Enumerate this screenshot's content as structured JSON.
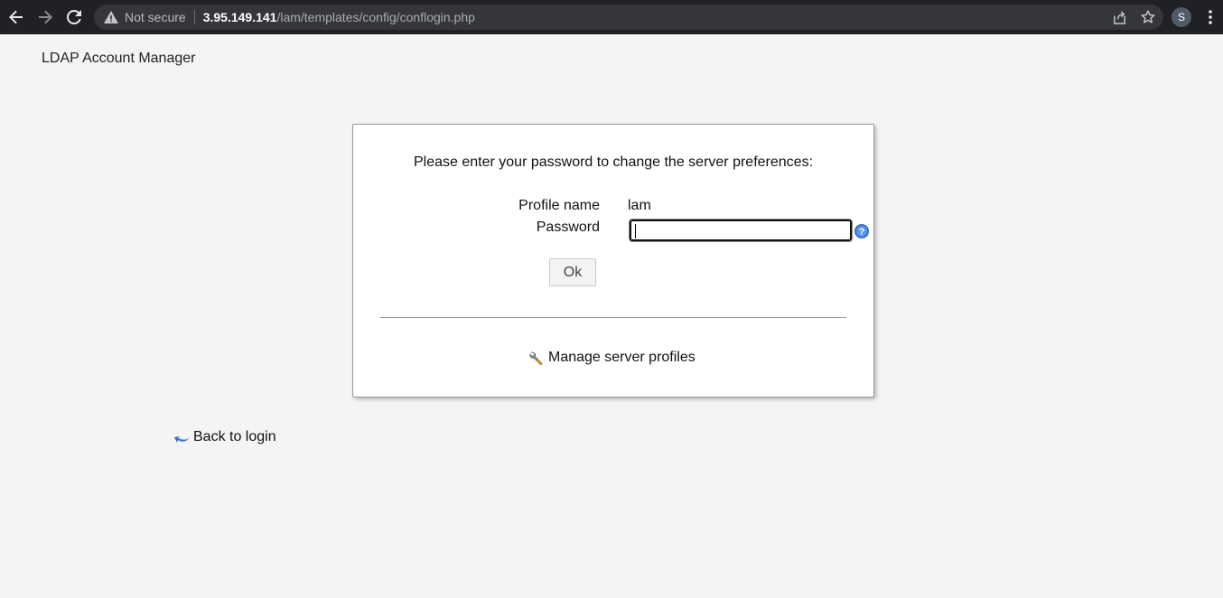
{
  "browser": {
    "security_label": "Not secure",
    "url_host": "3.95.149.141",
    "url_path": "/lam/templates/config/conflogin.php",
    "profile_initial": "S"
  },
  "page": {
    "app_title": "LDAP Account Manager",
    "prompt": "Please enter your password to change the server preferences:",
    "profile_label": "Profile name",
    "profile_value": "lam",
    "password_label": "Password",
    "password_value": "",
    "ok_label": "Ok",
    "manage_profiles_label": "Manage server profiles",
    "back_to_login_label": "Back to login"
  },
  "icons": {
    "back": "arrow-left-icon",
    "forward": "arrow-right-icon",
    "reload": "reload-icon",
    "warning": "warning-triangle-icon",
    "share": "share-icon",
    "bookmark": "star-icon",
    "menu": "kebab-menu-icon",
    "help": "help-icon",
    "manage": "wrench-icon",
    "back_login": "back-arrow-icon"
  },
  "colors": {
    "browser_bar": "#202124",
    "omnibox": "#35363a",
    "page_bg": "#f4f4f4",
    "help_blue": "#3b78d8"
  }
}
